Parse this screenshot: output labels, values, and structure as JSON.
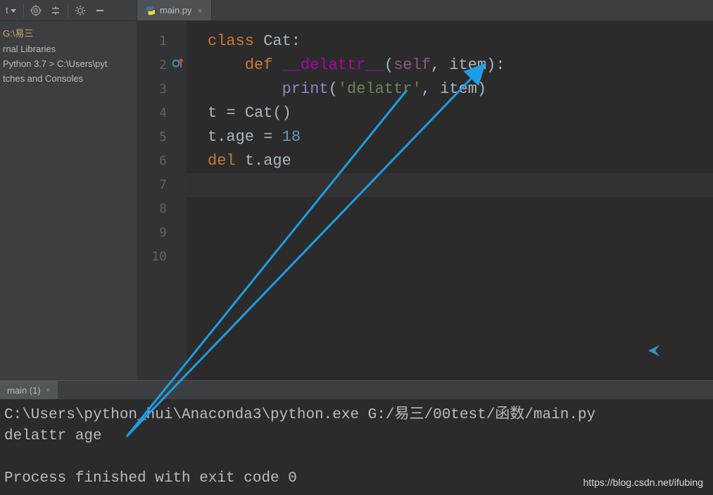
{
  "toolbar": {
    "label": "t",
    "tooltip_target": "target-icon",
    "tooltip_settings": "gear-icon"
  },
  "tab": {
    "filename": "main.py",
    "close": "×"
  },
  "tree": {
    "items": [
      {
        "label": "G:\\易三",
        "highlight": true
      },
      {
        "label": "rnal Libraries"
      },
      {
        "label": " Python 3.7 >  C:\\Users\\pyt"
      },
      {
        "label": "tches and Consoles"
      }
    ]
  },
  "code": {
    "lines": [
      {
        "num": "1"
      },
      {
        "num": "2"
      },
      {
        "num": "3"
      },
      {
        "num": "4"
      },
      {
        "num": "5"
      },
      {
        "num": "6"
      },
      {
        "num": "7"
      },
      {
        "num": "8"
      },
      {
        "num": "9"
      },
      {
        "num": "10"
      }
    ],
    "tokens": {
      "class_kw": "class",
      "classname": "Cat",
      "colon": ":",
      "def_kw": "def",
      "method": "__delattr__",
      "paren_open": "(",
      "self_kw": "self",
      "comma": ",",
      "param_item": "item",
      "paren_close": ")",
      "print_fn": "print",
      "str_delattr": "'delattr'",
      "t_var": "t",
      "assign": " = ",
      "cat_call": "Cat()",
      "dot": ".",
      "age_attr": "age",
      "eighteen": "18",
      "del_kw": "del",
      "space": " "
    }
  },
  "run": {
    "tab_label": "main (1)",
    "tab_close": "×",
    "output_line1": "C:\\Users\\python_hui\\Anaconda3\\python.exe G:/易三/00test/函数/main.py",
    "output_line2": "delattr age",
    "output_line3": "",
    "output_line4": "Process finished with exit code 0"
  },
  "watermark": "https://blog.csdn.net/ifubing"
}
